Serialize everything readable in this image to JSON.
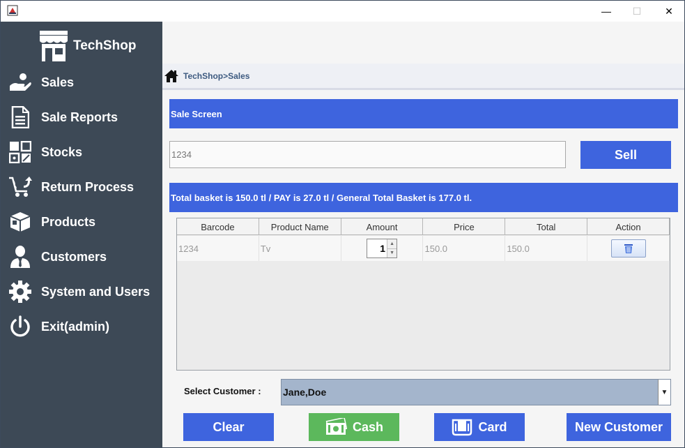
{
  "window": {
    "minimize": "—",
    "maximize": "☐",
    "close": "✕"
  },
  "brand": {
    "name": "TechShop"
  },
  "sidebar": {
    "items": [
      {
        "label": "Sales",
        "icon": "hand-coin-icon"
      },
      {
        "label": "Sale Reports",
        "icon": "document-icon"
      },
      {
        "label": "Stocks",
        "icon": "grid-icon"
      },
      {
        "label": "Return Process",
        "icon": "cart-return-icon"
      },
      {
        "label": "Products",
        "icon": "box-icon"
      },
      {
        "label": "Customers",
        "icon": "user-icon"
      },
      {
        "label": "System and Users",
        "icon": "gear-icon"
      },
      {
        "label": "Exit(admin)",
        "icon": "power-icon"
      }
    ]
  },
  "breadcrumb": {
    "text": "TechShop>Sales"
  },
  "sale_screen": {
    "title": "Sale Screen",
    "barcode_value": "1234",
    "sell_label": "Sell",
    "total_text": "Total basket is 150.0 tl / PAY is 27.0 tl / General Total Basket is 177.0 tl."
  },
  "table": {
    "columns": [
      "Barcode",
      "Product Name",
      "Amount",
      "Price",
      "Total",
      "Action"
    ],
    "rows": [
      {
        "barcode": "1234",
        "product_name": "Tv",
        "amount": "1",
        "price": "150.0",
        "total": "150.0"
      }
    ]
  },
  "customer": {
    "label": "Select Customer :",
    "selected": "Jane,Doe"
  },
  "actions": {
    "clear": "Clear",
    "cash": "Cash",
    "card": "Card",
    "new_customer": "New Customer"
  },
  "colors": {
    "sidebar": "#3d4956",
    "accent": "#3e64de",
    "cash": "#5cb85c",
    "select": "#a4b5cc"
  }
}
